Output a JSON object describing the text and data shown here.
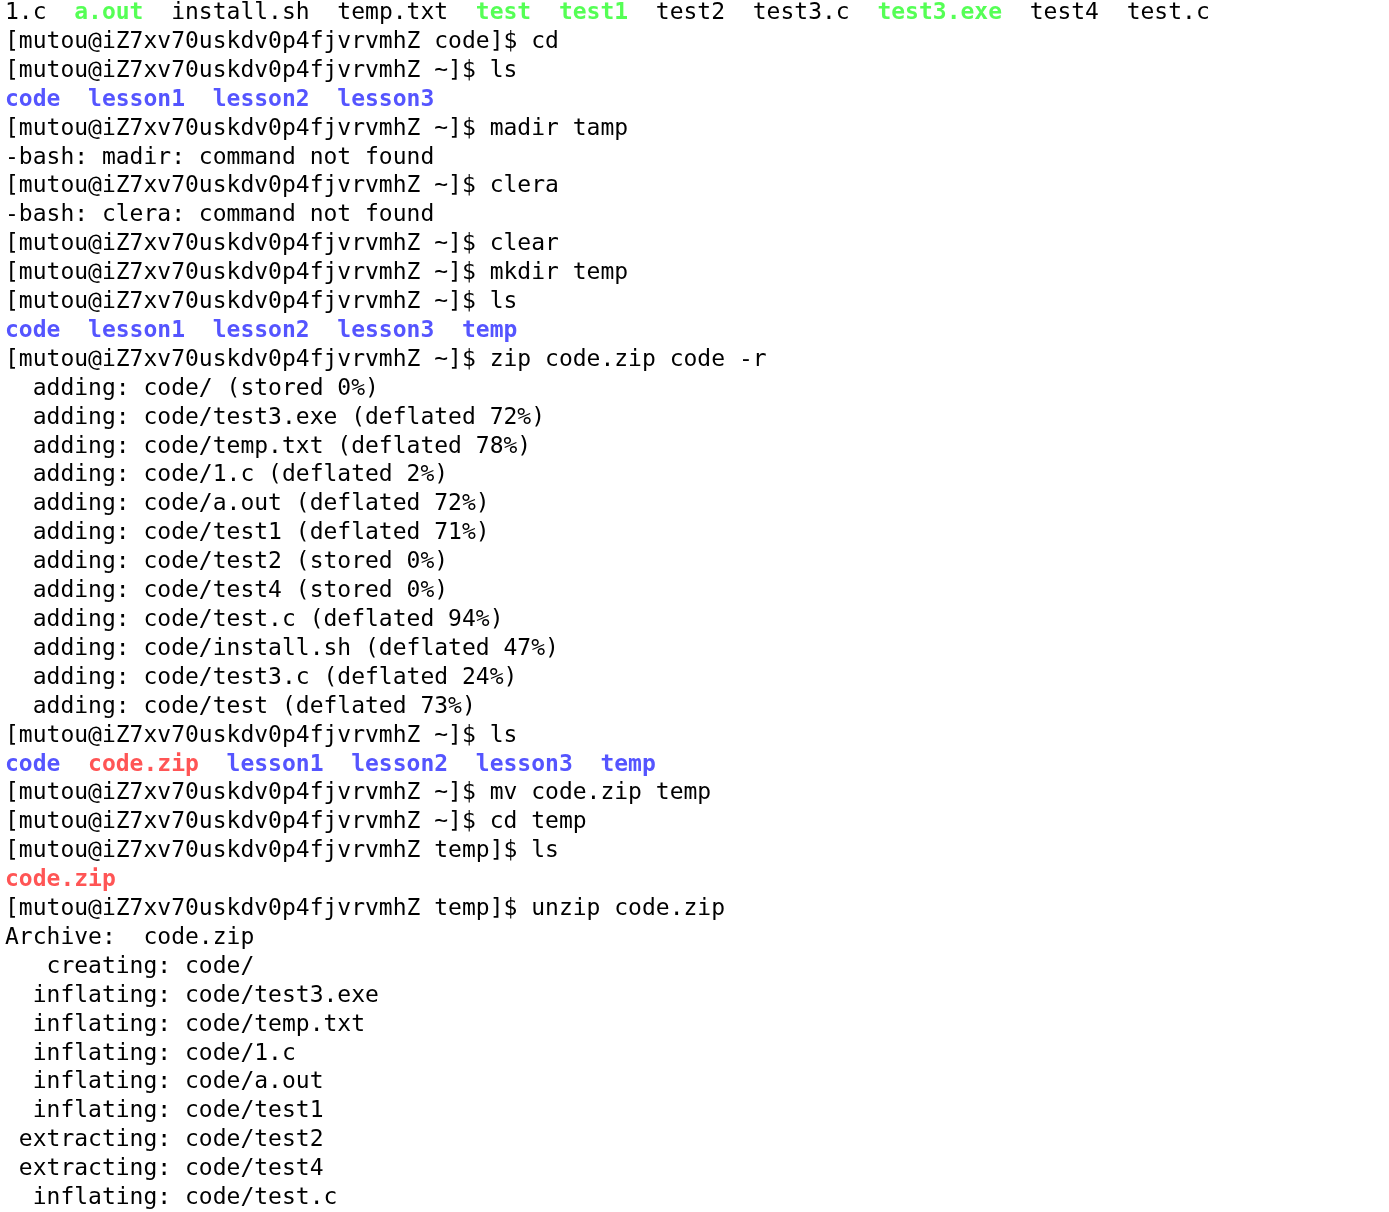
{
  "terminal": {
    "lines": [
      {
        "kind": "listing",
        "entries": [
          {
            "name": "1.c",
            "color": "#000000"
          },
          {
            "name": "a.out",
            "color": "#55ff55"
          },
          {
            "name": "install.sh",
            "color": "#000000"
          },
          {
            "name": "temp.txt",
            "color": "#000000"
          },
          {
            "name": "test",
            "color": "#55ff55"
          },
          {
            "name": "test1",
            "color": "#55ff55"
          },
          {
            "name": "test2",
            "color": "#000000"
          },
          {
            "name": "test3.c",
            "color": "#000000"
          },
          {
            "name": "test3.exe",
            "color": "#55ff55"
          },
          {
            "name": "test4",
            "color": "#000000"
          },
          {
            "name": "test.c",
            "color": "#000000"
          }
        ]
      },
      {
        "kind": "text",
        "text": "[mutou@iZ7xv70uskdv0p4fjvrvmhZ code]$ cd"
      },
      {
        "kind": "text",
        "text": "[mutou@iZ7xv70uskdv0p4fjvrvmhZ ~]$ ls"
      },
      {
        "kind": "listing",
        "entries": [
          {
            "name": "code",
            "color": "#5555ff"
          },
          {
            "name": "lesson1",
            "color": "#5555ff"
          },
          {
            "name": "lesson2",
            "color": "#5555ff"
          },
          {
            "name": "lesson3",
            "color": "#5555ff"
          }
        ]
      },
      {
        "kind": "text",
        "text": "[mutou@iZ7xv70uskdv0p4fjvrvmhZ ~]$ madir tamp"
      },
      {
        "kind": "text",
        "text": "-bash: madir: command not found"
      },
      {
        "kind": "text",
        "text": "[mutou@iZ7xv70uskdv0p4fjvrvmhZ ~]$ clera"
      },
      {
        "kind": "text",
        "text": "-bash: clera: command not found"
      },
      {
        "kind": "text",
        "text": "[mutou@iZ7xv70uskdv0p4fjvrvmhZ ~]$ clear"
      },
      {
        "kind": "text",
        "text": "[mutou@iZ7xv70uskdv0p4fjvrvmhZ ~]$ mkdir temp"
      },
      {
        "kind": "text",
        "text": "[mutou@iZ7xv70uskdv0p4fjvrvmhZ ~]$ ls"
      },
      {
        "kind": "listing",
        "entries": [
          {
            "name": "code",
            "color": "#5555ff"
          },
          {
            "name": "lesson1",
            "color": "#5555ff"
          },
          {
            "name": "lesson2",
            "color": "#5555ff"
          },
          {
            "name": "lesson3",
            "color": "#5555ff"
          },
          {
            "name": "temp",
            "color": "#5555ff"
          }
        ]
      },
      {
        "kind": "text",
        "text": "[mutou@iZ7xv70uskdv0p4fjvrvmhZ ~]$ zip code.zip code -r"
      },
      {
        "kind": "text",
        "text": "  adding: code/ (stored 0%)"
      },
      {
        "kind": "text",
        "text": "  adding: code/test3.exe (deflated 72%)"
      },
      {
        "kind": "text",
        "text": "  adding: code/temp.txt (deflated 78%)"
      },
      {
        "kind": "text",
        "text": "  adding: code/1.c (deflated 2%)"
      },
      {
        "kind": "text",
        "text": "  adding: code/a.out (deflated 72%)"
      },
      {
        "kind": "text",
        "text": "  adding: code/test1 (deflated 71%)"
      },
      {
        "kind": "text",
        "text": "  adding: code/test2 (stored 0%)"
      },
      {
        "kind": "text",
        "text": "  adding: code/test4 (stored 0%)"
      },
      {
        "kind": "text",
        "text": "  adding: code/test.c (deflated 94%)"
      },
      {
        "kind": "text",
        "text": "  adding: code/install.sh (deflated 47%)"
      },
      {
        "kind": "text",
        "text": "  adding: code/test3.c (deflated 24%)"
      },
      {
        "kind": "text",
        "text": "  adding: code/test (deflated 73%)"
      },
      {
        "kind": "text",
        "text": "[mutou@iZ7xv70uskdv0p4fjvrvmhZ ~]$ ls"
      },
      {
        "kind": "listing",
        "entries": [
          {
            "name": "code",
            "color": "#5555ff"
          },
          {
            "name": "code.zip",
            "color": "#ff5555"
          },
          {
            "name": "lesson1",
            "color": "#5555ff"
          },
          {
            "name": "lesson2",
            "color": "#5555ff"
          },
          {
            "name": "lesson3",
            "color": "#5555ff"
          },
          {
            "name": "temp",
            "color": "#5555ff"
          }
        ]
      },
      {
        "kind": "text",
        "text": "[mutou@iZ7xv70uskdv0p4fjvrvmhZ ~]$ mv code.zip temp"
      },
      {
        "kind": "text",
        "text": "[mutou@iZ7xv70uskdv0p4fjvrvmhZ ~]$ cd temp"
      },
      {
        "kind": "text",
        "text": "[mutou@iZ7xv70uskdv0p4fjvrvmhZ temp]$ ls"
      },
      {
        "kind": "listing",
        "entries": [
          {
            "name": "code.zip",
            "color": "#ff5555"
          }
        ]
      },
      {
        "kind": "text",
        "text": "[mutou@iZ7xv70uskdv0p4fjvrvmhZ temp]$ unzip code.zip"
      },
      {
        "kind": "text",
        "text": "Archive:  code.zip"
      },
      {
        "kind": "text",
        "text": "   creating: code/"
      },
      {
        "kind": "text",
        "text": "  inflating: code/test3.exe"
      },
      {
        "kind": "text",
        "text": "  inflating: code/temp.txt"
      },
      {
        "kind": "text",
        "text": "  inflating: code/1.c"
      },
      {
        "kind": "text",
        "text": "  inflating: code/a.out"
      },
      {
        "kind": "text",
        "text": "  inflating: code/test1"
      },
      {
        "kind": "text",
        "text": " extracting: code/test2"
      },
      {
        "kind": "text",
        "text": " extracting: code/test4"
      },
      {
        "kind": "text",
        "text": "  inflating: code/test.c"
      }
    ]
  }
}
